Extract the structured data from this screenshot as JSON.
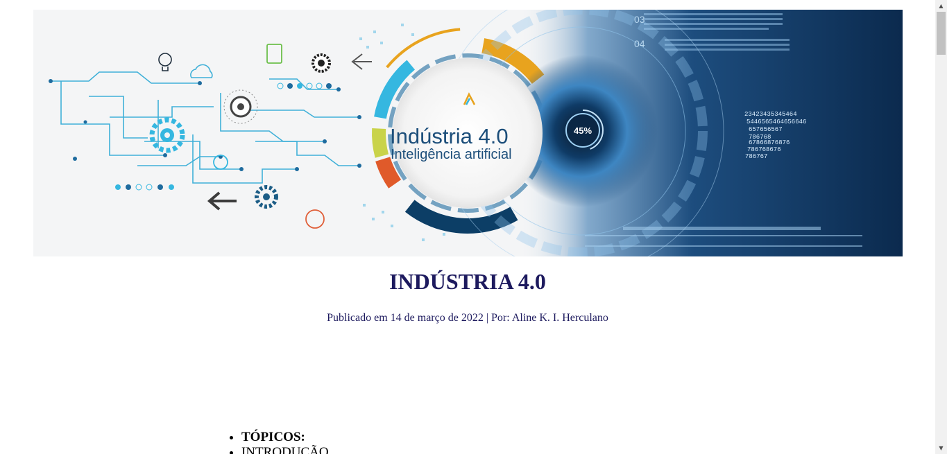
{
  "banner": {
    "brand_title": "Indústria 4.0",
    "brand_subtitle": "Inteligência artificial",
    "gauge_label": "45%",
    "hud_labels": [
      "03",
      "04"
    ],
    "hud_numbers": [
      "23423435345464",
      "5446565464656646",
      "657656567",
      "786768",
      "67866876876",
      "786768676",
      "786767"
    ],
    "colors": {
      "dark_blue": "#0c3e66",
      "accent_orange": "#e8a31e",
      "accent_red": "#e05a2a",
      "accent_green": "#c9d34a",
      "light_blue": "#35b7e0"
    }
  },
  "article": {
    "title": "INDÚSTRIA 4.0",
    "byline": "Publicado em 14 de março de 2022 | Por: Aline K. I. Herculano"
  },
  "topics": [
    {
      "label": "TÓPICOS:"
    },
    {
      "label": "INTRODUÇÃO"
    }
  ]
}
